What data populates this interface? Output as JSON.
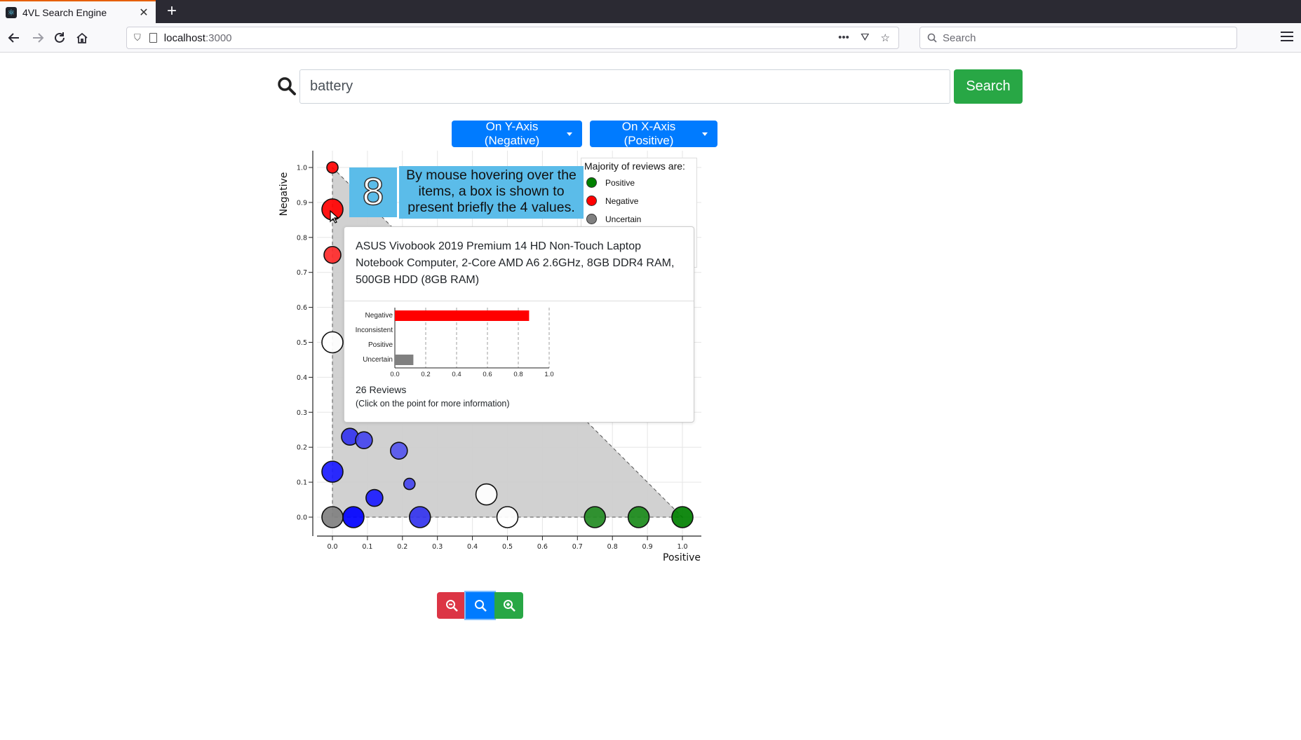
{
  "browser": {
    "tab_title": "4VL Search Engine",
    "url_host": "localhost",
    "url_port": ":3000",
    "search_placeholder": "Search"
  },
  "search": {
    "query": "battery",
    "button_label": "Search"
  },
  "axis_selectors": {
    "y_label": "On Y-Axis (Negative)",
    "x_label": "On X-Axis (Positive)"
  },
  "legend": {
    "title": "Majority of reviews are:",
    "items": [
      {
        "label": "Positive",
        "color": "#008000"
      },
      {
        "label": "Negative",
        "color": "#ff0000"
      },
      {
        "label": "Uncertain",
        "color": "#808080"
      }
    ]
  },
  "callout": {
    "number": "8",
    "text": "By mouse hovering over the items, a box is shown to present  briefly the 4 values."
  },
  "tooltip": {
    "title": "ASUS Vivobook 2019 Premium 14 HD Non-Touch Laptop Notebook Computer, 2-Core AMD A6 2.6GHz, 8GB DDR4 RAM, 500GB HDD (8GB RAM)",
    "reviews": "26 Reviews",
    "hint": "(Click on the point for more information)",
    "bars": [
      {
        "label": "Negative",
        "value": 0.87,
        "color": "#ff0000"
      },
      {
        "label": "Inconsistent",
        "value": 0,
        "color": "#0000ff"
      },
      {
        "label": "Positive",
        "value": 0,
        "color": "#008000"
      },
      {
        "label": "Uncertain",
        "value": 0.12,
        "color": "#808080"
      }
    ],
    "ticks": [
      "0.0",
      "0.2",
      "0.4",
      "0.6",
      "0.8",
      "1.0"
    ]
  },
  "chart_data": {
    "type": "scatter",
    "xlabel": "Positive",
    "ylabel": "Negative",
    "xlim": [
      0,
      1
    ],
    "ylim": [
      0,
      1
    ],
    "x_ticks": [
      "0.0",
      "0.1",
      "0.2",
      "0.3",
      "0.4",
      "0.5",
      "0.6",
      "0.7",
      "0.8",
      "0.9",
      "1.0"
    ],
    "y_ticks": [
      "0.0",
      "0.1",
      "0.2",
      "0.3",
      "0.4",
      "0.5",
      "0.6",
      "0.7",
      "0.8",
      "0.9",
      "1.0"
    ],
    "grid": true,
    "points": [
      {
        "x": 0.0,
        "y": 1.0,
        "size": "small",
        "color": "#ff0000"
      },
      {
        "x": 0.0,
        "y": 0.88,
        "size": "large",
        "color": "#ff0000"
      },
      {
        "x": 0.0,
        "y": 0.75,
        "size": "medium",
        "color": "#ff2a2a"
      },
      {
        "x": 0.0,
        "y": 0.5,
        "size": "large",
        "color": "#ffffff"
      },
      {
        "x": 0.05,
        "y": 0.23,
        "size": "medium",
        "color": "#3333ee"
      },
      {
        "x": 0.09,
        "y": 0.22,
        "size": "medium",
        "color": "#4444ee"
      },
      {
        "x": 0.19,
        "y": 0.19,
        "size": "medium",
        "color": "#5555ee"
      },
      {
        "x": 0.0,
        "y": 0.13,
        "size": "large",
        "color": "#1a1aff"
      },
      {
        "x": 0.22,
        "y": 0.095,
        "size": "small",
        "color": "#4444ee"
      },
      {
        "x": 0.12,
        "y": 0.055,
        "size": "medium",
        "color": "#1a1aff"
      },
      {
        "x": 0.44,
        "y": 0.065,
        "size": "large",
        "color": "#ffffff"
      },
      {
        "x": 0.0,
        "y": 0.0,
        "size": "large",
        "color": "#808080"
      },
      {
        "x": 0.06,
        "y": 0.0,
        "size": "large",
        "color": "#0000ff"
      },
      {
        "x": 0.25,
        "y": 0.0,
        "size": "large",
        "color": "#3333ee"
      },
      {
        "x": 0.5,
        "y": 0.0,
        "size": "large",
        "color": "#ffffff"
      },
      {
        "x": 0.75,
        "y": 0.0,
        "size": "large",
        "color": "#228b22"
      },
      {
        "x": 0.875,
        "y": 0.0,
        "size": "large",
        "color": "#1a8a1a"
      },
      {
        "x": 1.0,
        "y": 0.0,
        "size": "large",
        "color": "#008000"
      }
    ]
  }
}
